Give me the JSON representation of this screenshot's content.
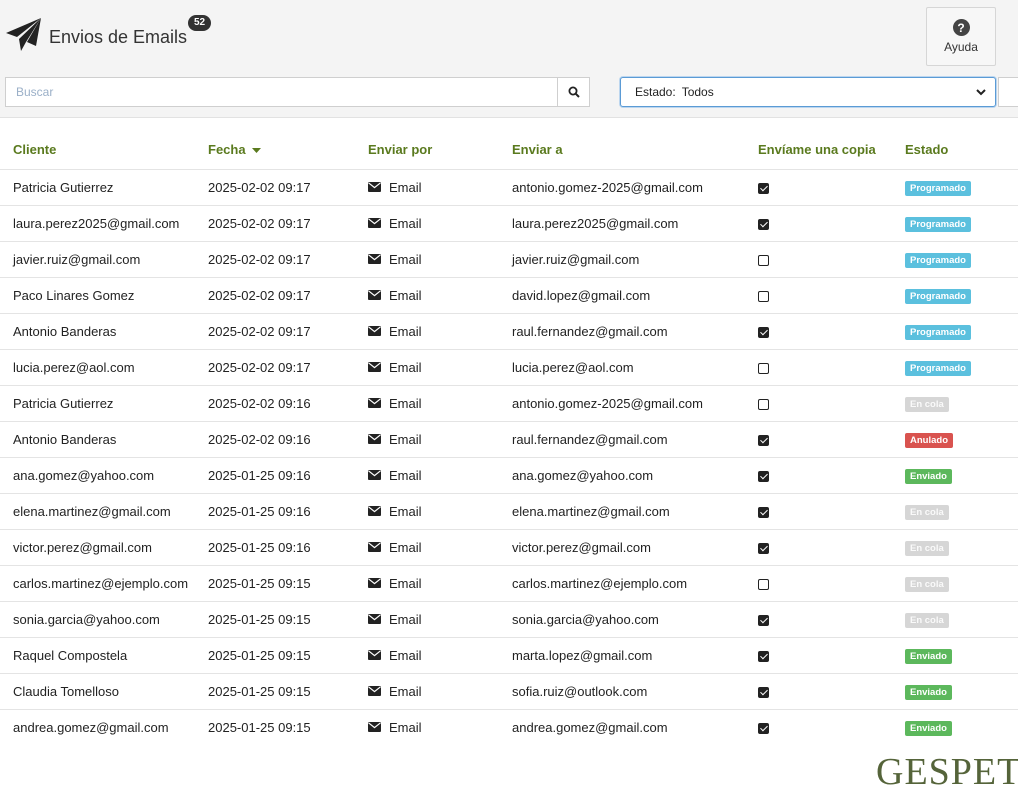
{
  "header": {
    "title": "Envios de Emails",
    "count": "52",
    "help_label": "Ayuda",
    "icon": "paper-plane-icon"
  },
  "search": {
    "placeholder": "Buscar",
    "icon": "search-icon"
  },
  "filter": {
    "label": "Estado:",
    "value": "Todos"
  },
  "table": {
    "columns": [
      "Cliente",
      "Fecha",
      "Enviar por",
      "Enviar a",
      "Envíame una copia",
      "Estado"
    ],
    "rows": [
      {
        "cliente": "Patricia Gutierrez",
        "fecha": "2025-02-02 09:17",
        "enviar_por": "Email",
        "enviar_a": "antonio.gomez-2025@gmail.com",
        "copia": true,
        "estado": "Programado"
      },
      {
        "cliente": "laura.perez2025@gmail.com",
        "fecha": "2025-02-02 09:17",
        "enviar_por": "Email",
        "enviar_a": "laura.perez2025@gmail.com",
        "copia": true,
        "estado": "Programado"
      },
      {
        "cliente": "javier.ruiz@gmail.com",
        "fecha": "2025-02-02 09:17",
        "enviar_por": "Email",
        "enviar_a": "javier.ruiz@gmail.com",
        "copia": false,
        "estado": "Programado"
      },
      {
        "cliente": "Paco Linares Gomez",
        "fecha": "2025-02-02 09:17",
        "enviar_por": "Email",
        "enviar_a": "david.lopez@gmail.com",
        "copia": false,
        "estado": "Programado"
      },
      {
        "cliente": "Antonio Banderas",
        "fecha": "2025-02-02 09:17",
        "enviar_por": "Email",
        "enviar_a": "raul.fernandez@gmail.com",
        "copia": true,
        "estado": "Programado"
      },
      {
        "cliente": "lucia.perez@aol.com",
        "fecha": "2025-02-02 09:17",
        "enviar_por": "Email",
        "enviar_a": "lucia.perez@aol.com",
        "copia": false,
        "estado": "Programado"
      },
      {
        "cliente": "Patricia Gutierrez",
        "fecha": "2025-02-02 09:16",
        "enviar_por": "Email",
        "enviar_a": "antonio.gomez-2025@gmail.com",
        "copia": false,
        "estado": "En cola"
      },
      {
        "cliente": "Antonio Banderas",
        "fecha": "2025-02-02 09:16",
        "enviar_por": "Email",
        "enviar_a": "raul.fernandez@gmail.com",
        "copia": true,
        "estado": "Anulado"
      },
      {
        "cliente": "ana.gomez@yahoo.com",
        "fecha": "2025-01-25 09:16",
        "enviar_por": "Email",
        "enviar_a": "ana.gomez@yahoo.com",
        "copia": true,
        "estado": "Enviado"
      },
      {
        "cliente": "elena.martinez@gmail.com",
        "fecha": "2025-01-25 09:16",
        "enviar_por": "Email",
        "enviar_a": "elena.martinez@gmail.com",
        "copia": true,
        "estado": "En cola"
      },
      {
        "cliente": "victor.perez@gmail.com",
        "fecha": "2025-01-25 09:16",
        "enviar_por": "Email",
        "enviar_a": "victor.perez@gmail.com",
        "copia": true,
        "estado": "En cola"
      },
      {
        "cliente": "carlos.martinez@ejemplo.com",
        "fecha": "2025-01-25 09:15",
        "enviar_por": "Email",
        "enviar_a": "carlos.martinez@ejemplo.com",
        "copia": false,
        "estado": "En cola"
      },
      {
        "cliente": "sonia.garcia@yahoo.com",
        "fecha": "2025-01-25 09:15",
        "enviar_por": "Email",
        "enviar_a": "sonia.garcia@yahoo.com",
        "copia": true,
        "estado": "En cola"
      },
      {
        "cliente": "Raquel Compostela",
        "fecha": "2025-01-25 09:15",
        "enviar_por": "Email",
        "enviar_a": "marta.lopez@gmail.com",
        "copia": true,
        "estado": "Enviado"
      },
      {
        "cliente": "Claudia Tomelloso",
        "fecha": "2025-01-25 09:15",
        "enviar_por": "Email",
        "enviar_a": "sofia.ruiz@outlook.com",
        "copia": true,
        "estado": "Enviado"
      },
      {
        "cliente": "andrea.gomez@gmail.com",
        "fecha": "2025-01-25 09:15",
        "enviar_por": "Email",
        "enviar_a": "andrea.gomez@gmail.com",
        "copia": true,
        "estado": "Enviado"
      }
    ]
  },
  "status_colors": {
    "Programado": "#5bc0de",
    "En cola": "#d6d6d6",
    "Anulado": "#d9534f",
    "Enviado": "#5cb85c"
  },
  "logo": {
    "text": "GESPET"
  }
}
